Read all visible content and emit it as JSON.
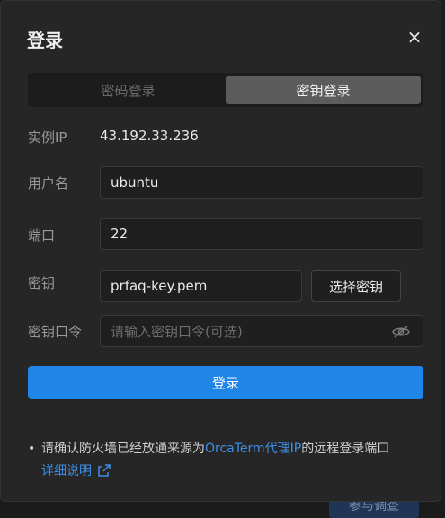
{
  "dialog": {
    "title": "登录",
    "close_icon": "×"
  },
  "tabs": [
    {
      "label": "密码登录",
      "active": false
    },
    {
      "label": "密钥登录",
      "active": true
    }
  ],
  "form": {
    "instance_ip": {
      "label": "实例IP",
      "value": "43.192.33.236"
    },
    "username": {
      "label": "用户名",
      "value": "ubuntu"
    },
    "port": {
      "label": "端口",
      "value": "22"
    },
    "key": {
      "label": "密钥",
      "value": "prfaq-key.pem",
      "select_button": "选择密钥"
    },
    "passphrase": {
      "label": "密钥口令",
      "placeholder": "请输入密钥口令(可选)",
      "icon": "eye-off-icon"
    }
  },
  "login_button": "登录",
  "notice": {
    "text_before": "请确认防火墙已经放通来源为",
    "link": "OrcaTerm代理IP",
    "text_after": "的远程登录端口",
    "detail_link": "详细说明"
  },
  "background": {
    "partial_button": "参与调查"
  },
  "colors": {
    "primary": "#1f86e8",
    "link": "#3c8ee8",
    "dialog_bg": "#262626"
  }
}
